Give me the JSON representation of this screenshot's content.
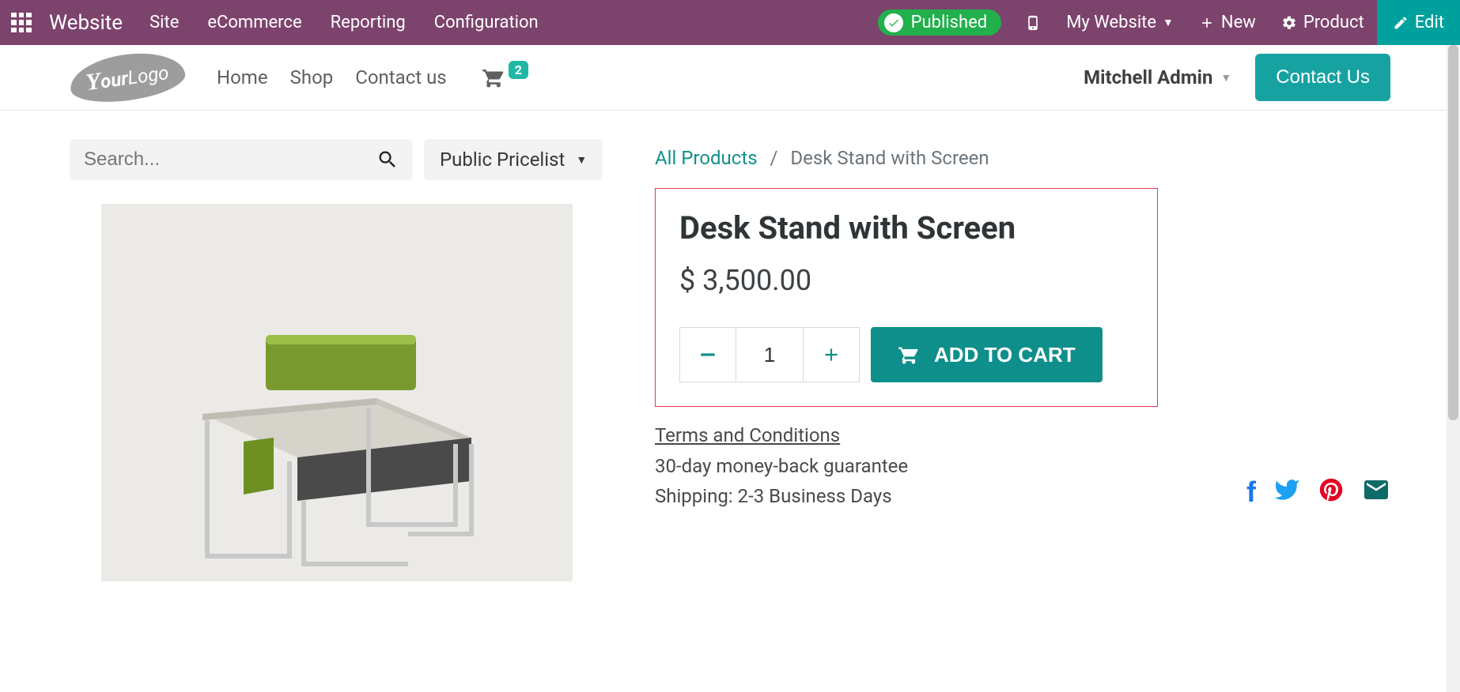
{
  "topbar": {
    "brand": "Website",
    "nav": [
      "Site",
      "eCommerce",
      "Reporting",
      "Configuration"
    ],
    "published_label": "Published",
    "my_website_label": "My Website",
    "new_label": "New",
    "product_label": "Product",
    "edit_label": "Edit"
  },
  "siteheader": {
    "logo_text": "YourLogo",
    "nav": {
      "home": "Home",
      "shop": "Shop",
      "contact": "Contact us"
    },
    "cart_count": "2",
    "user_name": "Mitchell Admin",
    "contact_button": "Contact Us"
  },
  "toolbar": {
    "search_placeholder": "Search...",
    "pricelist_label": "Public Pricelist"
  },
  "breadcrumb": {
    "root": "All Products",
    "current": "Desk Stand with Screen"
  },
  "product": {
    "title": "Desk Stand with Screen",
    "price": "$ 3,500.00",
    "qty": "1",
    "add_to_cart": "ADD TO CART"
  },
  "terms": {
    "tc": "Terms and Conditions",
    "guarantee": "30-day money-back guarantee",
    "shipping": "Shipping: 2-3 Business Days"
  },
  "colors": {
    "brand_purple": "#7C436C",
    "teal": "#0f8f8b",
    "green": "#21b04b",
    "highlight_border": "#e63946"
  }
}
